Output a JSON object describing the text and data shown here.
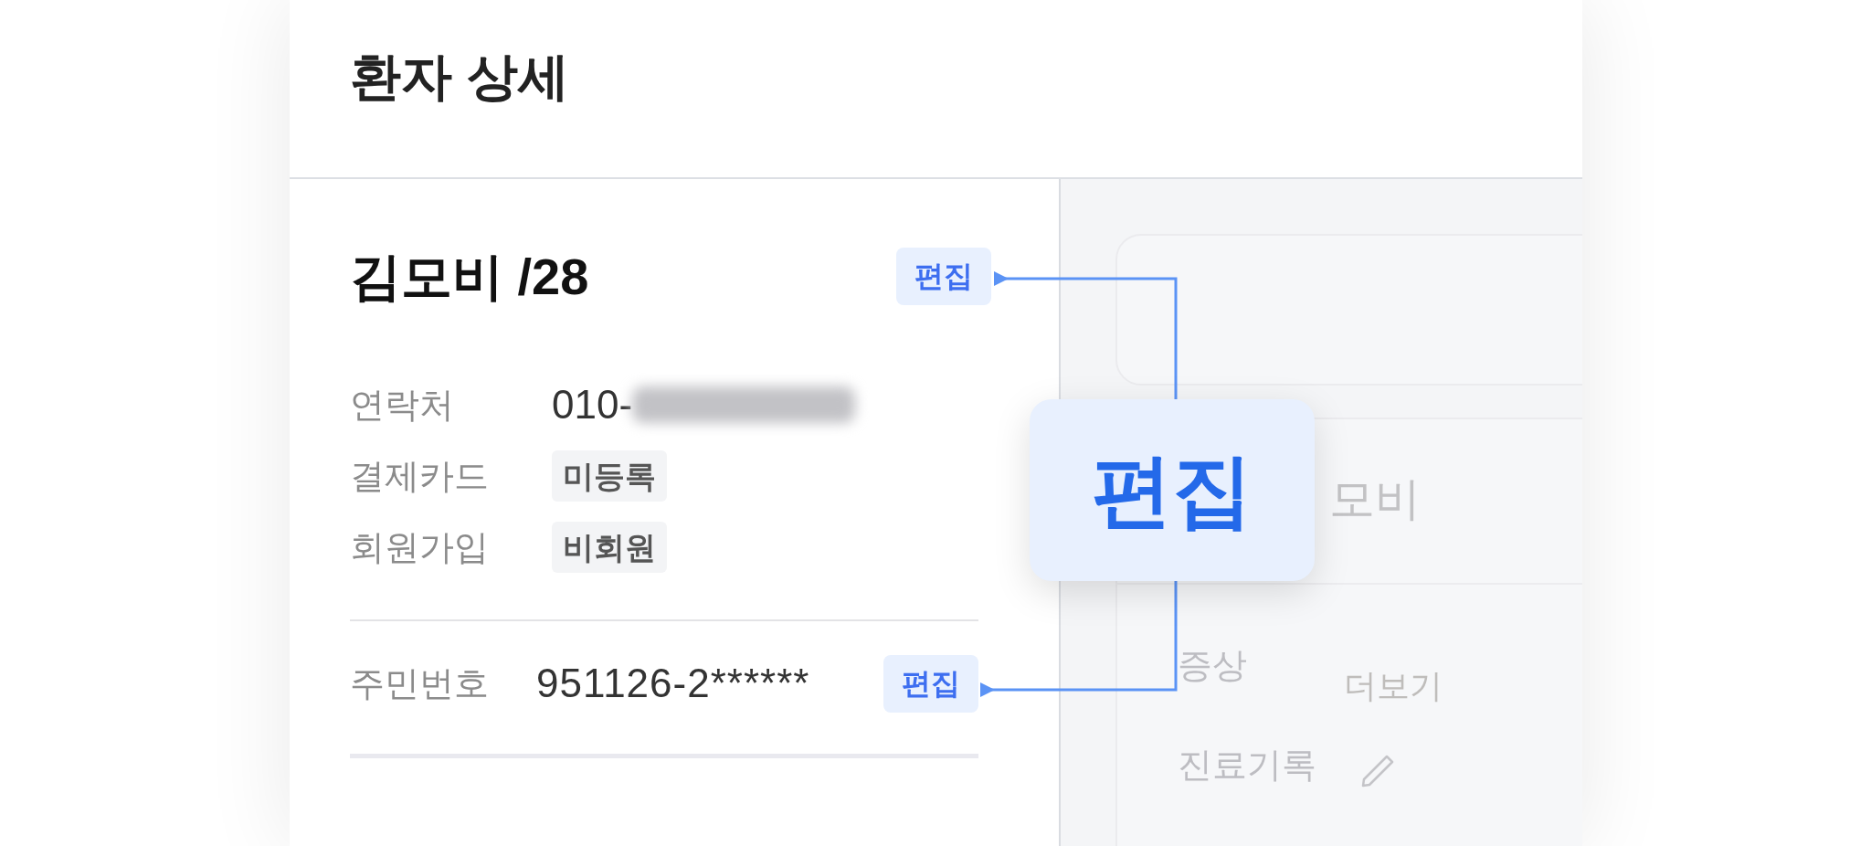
{
  "header": {
    "title": "환자 상세"
  },
  "patient": {
    "name_age": "김모비 /28",
    "edit_button": "편집",
    "info_rows": [
      {
        "kind": "text",
        "label": "연락처",
        "value": "010-",
        "blurred": true
      },
      {
        "kind": "tag",
        "label": "결제카드",
        "value": "미등록",
        "blurred": false
      },
      {
        "kind": "tag",
        "label": "회원가입",
        "value": "비회원",
        "blurred": false
      }
    ],
    "id_row": {
      "label": "주민번호",
      "value": "951126-2******",
      "edit_button": "편집"
    }
  },
  "background_card": {
    "name": "모비",
    "rows": [
      {
        "kind": "more",
        "label": "증상",
        "action": "더보기"
      },
      {
        "kind": "edit",
        "label": "진료기록"
      }
    ]
  },
  "callout": {
    "text": "편집"
  }
}
